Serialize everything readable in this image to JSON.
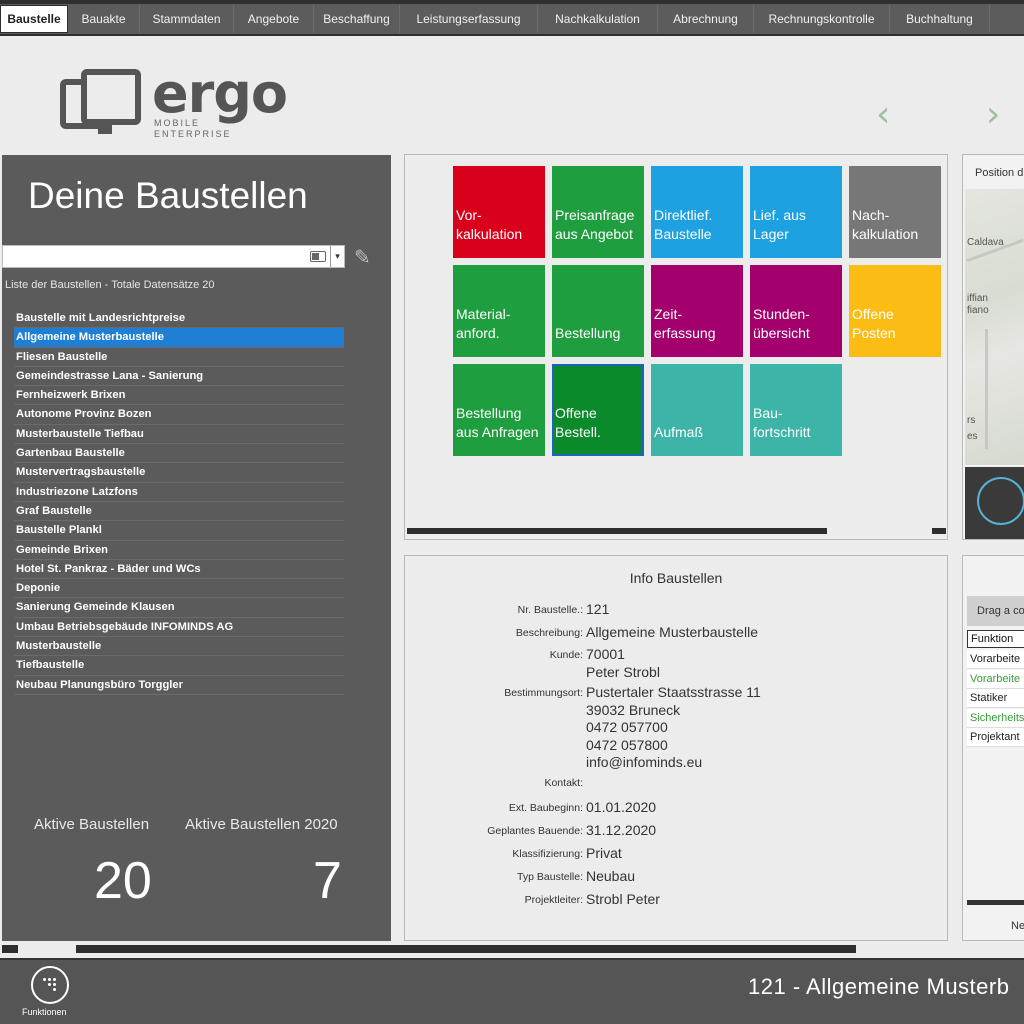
{
  "menu": {
    "items": [
      "Baustelle",
      "Bauakte",
      "Stammdaten",
      "Angebote",
      "Beschaffung",
      "Leistungserfassung",
      "Nachkalkulation",
      "Abrechnung",
      "Rechnungskontrolle",
      "Buchhaltung"
    ]
  },
  "logo": {
    "word": "ergo",
    "sub1": "MOBILE",
    "sub2": "ENTERPRISE"
  },
  "nav": {
    "prev": "‹",
    "next": "›"
  },
  "left_panel": {
    "title": "Deine Baustellen",
    "count_text": "Liste der Baustellen - Totale Datensätze 20",
    "items": [
      "Baustelle mit Landesrichtpreise",
      "Allgemeine Musterbaustelle",
      "Fliesen Baustelle",
      "Gemeindestrasse Lana - Sanierung",
      "Fernheizwerk Brixen",
      "Autonome Provinz Bozen",
      "Musterbaustelle Tiefbau",
      "Gartenbau Baustelle",
      "Mustervertragsbaustelle",
      "Industriezone Latzfons",
      "Graf Baustelle",
      "Baustelle Plankl",
      "Gemeinde Brixen",
      "Hotel St. Pankraz - Bäder und WCs",
      "Deponie",
      "Sanierung Gemeinde Klausen",
      "Umbau Betriebsgebäude INFOMINDS AG",
      "Musterbaustelle",
      "Tiefbaustelle",
      "Neubau Planungsbüro Torggler"
    ],
    "selected_index": 1,
    "stats": {
      "active_label": "Aktive Baustellen",
      "active_value": "20",
      "active_year_label": "Aktive Baustellen 2020",
      "active_year_value": "7"
    }
  },
  "tiles": [
    {
      "line1": "Vor-",
      "line2": "kalkulation",
      "color": "#d9001b"
    },
    {
      "line1": "Preisanfrage",
      "line2": "aus Angebot",
      "color": "#1e9e3e"
    },
    {
      "line1": "Direktlief.",
      "line2": "Baustelle",
      "color": "#1da1e0"
    },
    {
      "line1": "Lief. aus",
      "line2": "Lager",
      "color": "#1da1e0"
    },
    {
      "line1": "Nach-",
      "line2": "kalkulation",
      "color": "#777777"
    },
    {
      "line1": "Material-",
      "line2": "anford.",
      "color": "#1e9e3e"
    },
    {
      "line1": "",
      "line2": "Bestellung",
      "color": "#1e9e3e"
    },
    {
      "line1": "Zeit-",
      "line2": "erfassung",
      "color": "#a3006e"
    },
    {
      "line1": "Stunden-",
      "line2": "übersicht",
      "color": "#a3006e"
    },
    {
      "line1": "Offene",
      "line2": "Posten",
      "color": "#fbbd14"
    },
    {
      "line1": "Bestellung",
      "line2": "aus Anfragen",
      "color": "#1e9e3e"
    },
    {
      "line1": "Offene",
      "line2": "Bestell.",
      "color": "#0a8a2a"
    },
    {
      "line1": "",
      "line2": "Aufmaß",
      "color": "#3cb4a8"
    },
    {
      "line1": "Bau-",
      "line2": "fortschritt",
      "color": "#3cb4a8"
    }
  ],
  "info": {
    "title": "Info Baustellen",
    "fields": [
      {
        "label": "Nr. Baustelle.:",
        "value": "121"
      },
      {
        "label": "Beschreibung:",
        "value": "Allgemeine Musterbaustelle"
      },
      {
        "label": "Kunde:",
        "value": "70001\nPeter Strobl"
      },
      {
        "label": "Bestimmungsort:",
        "value": "Pustertaler Staatsstrasse 11\n39032 Bruneck\n0472 057700\n0472 057800\ninfo@infominds.eu"
      },
      {
        "label": "Kontakt:",
        "value": ""
      },
      {
        "label": "Ext. Baubeginn:",
        "value": "01.01.2020"
      },
      {
        "label": "Geplantes Bauende:",
        "value": "31.12.2020"
      },
      {
        "label": "Klassifizierung:",
        "value": "Privat"
      },
      {
        "label": "Typ Baustelle:",
        "value": "Neubau"
      },
      {
        "label": "Projektleiter:",
        "value": "Strobl Peter"
      }
    ]
  },
  "map": {
    "header": "Position d",
    "labels": [
      "Caldava",
      "iffian",
      "fiano",
      "rs",
      "es"
    ]
  },
  "grid": {
    "drag_text": "Drag a co",
    "header": "Funktion",
    "rows": [
      "Vorarbeite",
      "Vorarbeite",
      "Statiker",
      "Sicherheits",
      "Projektant"
    ],
    "footer": "Ne"
  },
  "footer": {
    "functions_label": "Funktionen",
    "title": "121 - Allgemeine Musterb"
  }
}
